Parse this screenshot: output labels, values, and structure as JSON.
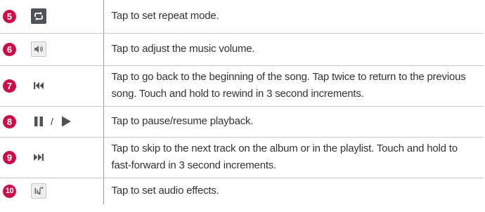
{
  "rows": [
    {
      "number": "5",
      "icons": [
        "repeat-icon"
      ],
      "text": "Tap to set repeat mode."
    },
    {
      "number": "6",
      "icons": [
        "volume-icon"
      ],
      "text": "Tap to adjust the music volume."
    },
    {
      "number": "7",
      "icons": [
        "previous-track-icon"
      ],
      "text": "Tap to go back to the beginning of the song. Tap twice to return to the previous song. Touch and hold to rewind in 3 second increments."
    },
    {
      "number": "8",
      "icons": [
        "pause-icon",
        "play-icon"
      ],
      "separator": "/",
      "text": "Tap to pause/resume playback."
    },
    {
      "number": "9",
      "icons": [
        "next-track-icon"
      ],
      "text": "Tap to skip to the next track on the album or in the playlist. Touch and hold to fast-forward in 3 second increments."
    },
    {
      "number": "10",
      "icons": [
        "audio-effects-icon"
      ],
      "text": "Tap to set audio effects."
    }
  ],
  "colors": {
    "badge": "#c80f4b",
    "icon_dark": "#4f5358",
    "text": "#333333",
    "rule": "#c9c9c9"
  }
}
